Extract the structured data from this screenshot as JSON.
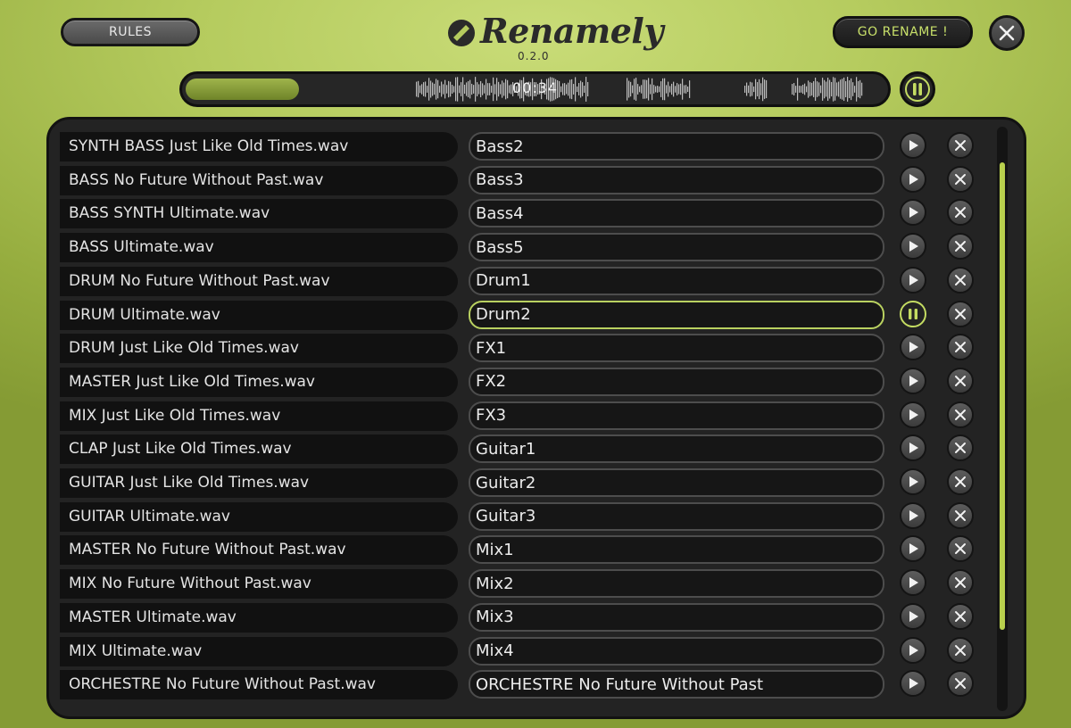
{
  "header": {
    "rules_label": "RULES",
    "rename_label": "GO RENAME !",
    "app_name": "Renamely",
    "version": "0.2.0",
    "accent_color": "#b9d160"
  },
  "player": {
    "time": "00:34",
    "progress": 0.16,
    "state": "playing",
    "pause_icon": "pause-icon"
  },
  "files": [
    {
      "original": "SYNTH BASS Just Like Old Times.wav",
      "new_name": "Bass2",
      "state": "idle"
    },
    {
      "original": "BASS No Future Without Past.wav",
      "new_name": "Bass3",
      "state": "idle"
    },
    {
      "original": "BASS SYNTH Ultimate.wav",
      "new_name": "Bass4",
      "state": "idle"
    },
    {
      "original": "BASS Ultimate.wav",
      "new_name": "Bass5",
      "state": "idle"
    },
    {
      "original": "DRUM No Future Without Past.wav",
      "new_name": "Drum1",
      "state": "idle"
    },
    {
      "original": "DRUM Ultimate.wav",
      "new_name": "Drum2",
      "state": "playing"
    },
    {
      "original": "DRUM Just Like Old Times.wav",
      "new_name": "FX1",
      "state": "idle"
    },
    {
      "original": "MASTER Just Like Old Times.wav",
      "new_name": "FX2",
      "state": "idle"
    },
    {
      "original": "MIX Just Like Old Times.wav",
      "new_name": "FX3",
      "state": "idle"
    },
    {
      "original": "CLAP Just Like Old Times.wav",
      "new_name": "Guitar1",
      "state": "idle"
    },
    {
      "original": "GUITAR Just Like Old Times.wav",
      "new_name": "Guitar2",
      "state": "idle"
    },
    {
      "original": "GUITAR Ultimate.wav",
      "new_name": "Guitar3",
      "state": "idle"
    },
    {
      "original": "MASTER No Future Without Past.wav",
      "new_name": "Mix1",
      "state": "idle"
    },
    {
      "original": "MIX No Future Without Past.wav",
      "new_name": "Mix2",
      "state": "idle"
    },
    {
      "original": "MASTER Ultimate.wav",
      "new_name": "Mix3",
      "state": "idle"
    },
    {
      "original": "MIX Ultimate.wav",
      "new_name": "Mix4",
      "state": "idle"
    },
    {
      "original": "ORCHESTRE No Future Without Past.wav",
      "new_name": "ORCHESTRE No Future Without Past",
      "state": "idle"
    }
  ],
  "scroll": {
    "position": 0.0,
    "visible_fraction": 0.8
  }
}
